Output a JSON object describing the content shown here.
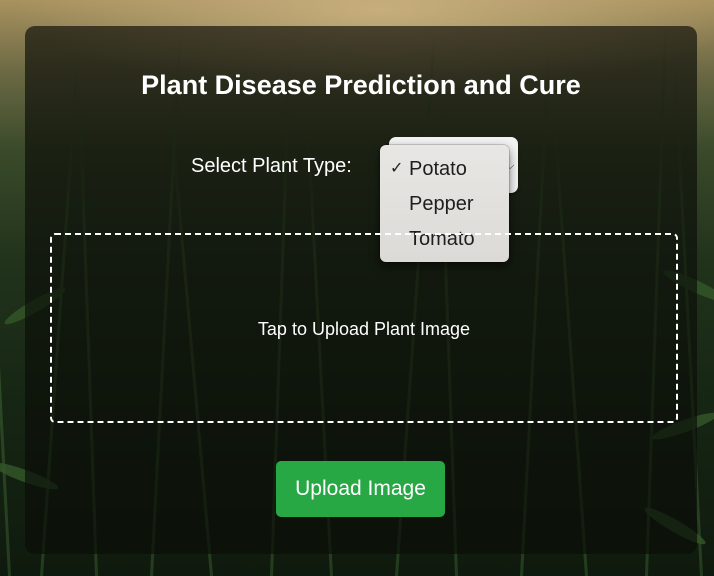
{
  "page": {
    "title": "Plant Disease Prediction and Cure"
  },
  "plant_select": {
    "label": "Select Plant Type:",
    "selected": "Potato",
    "check_mark": "✓",
    "options": [
      "Potato",
      "Pepper",
      "Tomato"
    ]
  },
  "upload_zone": {
    "text": "Tap to Upload Plant Image"
  },
  "upload_button": {
    "label": "Upload Image",
    "color": "#28a745"
  },
  "icons": {
    "dropdown_chevron": "chevron-down-icon",
    "selected_check": "check-icon"
  }
}
